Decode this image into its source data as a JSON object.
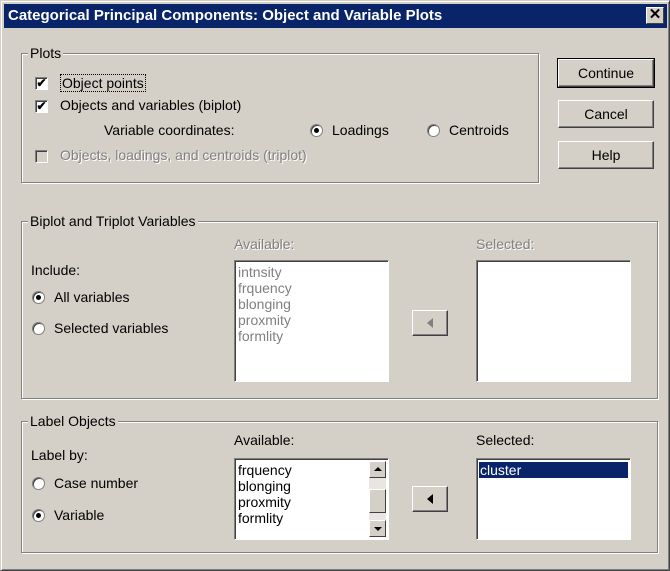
{
  "window": {
    "title": "Categorical Principal Components: Object and Variable Plots",
    "close_glyph": "✕"
  },
  "plots": {
    "legend": "Plots",
    "object_points": {
      "label": "Object points",
      "checked": true
    },
    "objects_and_variables": {
      "label": "Objects and variables (biplot)",
      "checked": true
    },
    "variable_coordinates_label": "Variable coordinates:",
    "loadings": {
      "label": "Loadings",
      "selected": true
    },
    "centroids": {
      "label": "Centroids",
      "selected": false
    },
    "triplot": {
      "label": "Objects, loadings, and centroids (triplot)",
      "checked": false,
      "enabled": false
    }
  },
  "buttons": {
    "continue": "Continue",
    "cancel": "Cancel",
    "help": "Help"
  },
  "biplot_triplot": {
    "legend": "Biplot and Triplot Variables",
    "include_label": "Include:",
    "all_variables": {
      "label": "All variables",
      "selected": true
    },
    "selected_variables": {
      "label": "Selected variables",
      "selected": false
    },
    "available_label": "Available:",
    "available_items": [
      "intnsity",
      "frquency",
      "blonging",
      "proxmity",
      "formlity"
    ],
    "selected_label": "Selected:",
    "selected_items": []
  },
  "label_objects": {
    "legend": "Label Objects",
    "label_by": "Label by:",
    "case_number": {
      "label": "Case number",
      "selected": false
    },
    "variable": {
      "label": "Variable",
      "selected": true
    },
    "available_label": "Available:",
    "available_items": [
      "frquency",
      "blonging",
      "proxmity",
      "formlity"
    ],
    "selected_label": "Selected:",
    "selected_items": [
      "cluster"
    ]
  },
  "colors": {
    "titlebar": "#0a246a",
    "face": "#d4d0c8",
    "selection": "#0a246a"
  }
}
